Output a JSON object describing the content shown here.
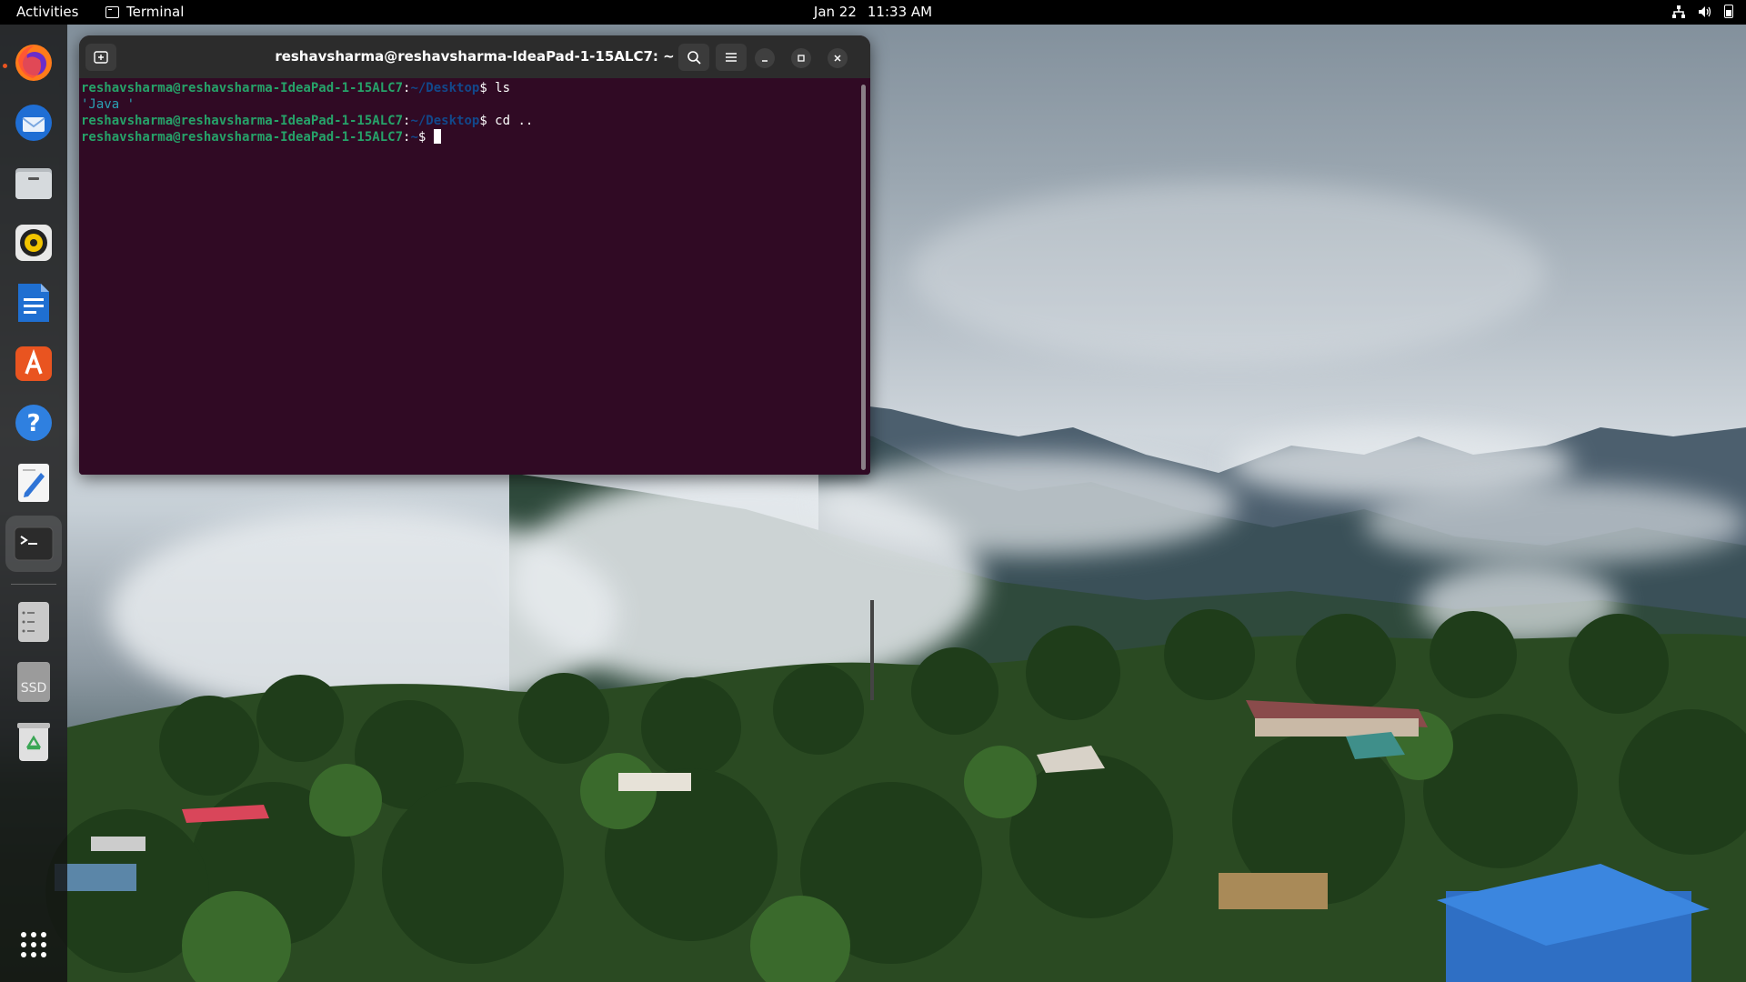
{
  "topbar": {
    "activities": "Activities",
    "app_name": "Terminal",
    "date": "Jan 22",
    "time": "11:33 AM"
  },
  "dock": {
    "items": [
      {
        "name": "firefox",
        "icon": "firefox-icon"
      },
      {
        "name": "thunderbird",
        "icon": "thunderbird-icon"
      },
      {
        "name": "files",
        "icon": "files-icon"
      },
      {
        "name": "rhythmbox",
        "icon": "rhythmbox-icon"
      },
      {
        "name": "libreoffice-writer",
        "icon": "writer-icon"
      },
      {
        "name": "ubuntu-software",
        "icon": "software-icon"
      },
      {
        "name": "help",
        "icon": "help-icon"
      },
      {
        "name": "text-editor",
        "icon": "text-editor-icon"
      },
      {
        "name": "terminal",
        "icon": "terminal-icon",
        "active": true
      },
      {
        "name": "drive",
        "icon": "drive-icon"
      },
      {
        "name": "ssd",
        "icon": "ssd-icon",
        "label": "SSD"
      },
      {
        "name": "trash",
        "icon": "trash-icon"
      },
      {
        "name": "show-apps",
        "icon": "app-grid-icon"
      }
    ]
  },
  "terminal": {
    "title": "reshavsharma@reshavsharma-IdeaPad-1-15ALC7: ~",
    "lines": [
      {
        "user": "reshavsharma@reshavsharma-IdeaPad-1-15ALC7",
        "sep": ":",
        "path": "~/Desktop",
        "prompt": "$ ",
        "cmd": "ls"
      },
      {
        "output": "'Java '"
      },
      {
        "user": "reshavsharma@reshavsharma-IdeaPad-1-15ALC7",
        "sep": ":",
        "path": "~/Desktop",
        "prompt": "$ ",
        "cmd": "cd .."
      },
      {
        "user": "reshavsharma@reshavsharma-IdeaPad-1-15ALC7",
        "sep": ":",
        "path": "~",
        "prompt": "$ ",
        "cmd": ""
      }
    ]
  },
  "colors": {
    "terminal_bg": "#300a24",
    "prompt_user": "#26a269",
    "prompt_path": "#12488b",
    "accent": "#e95420"
  }
}
